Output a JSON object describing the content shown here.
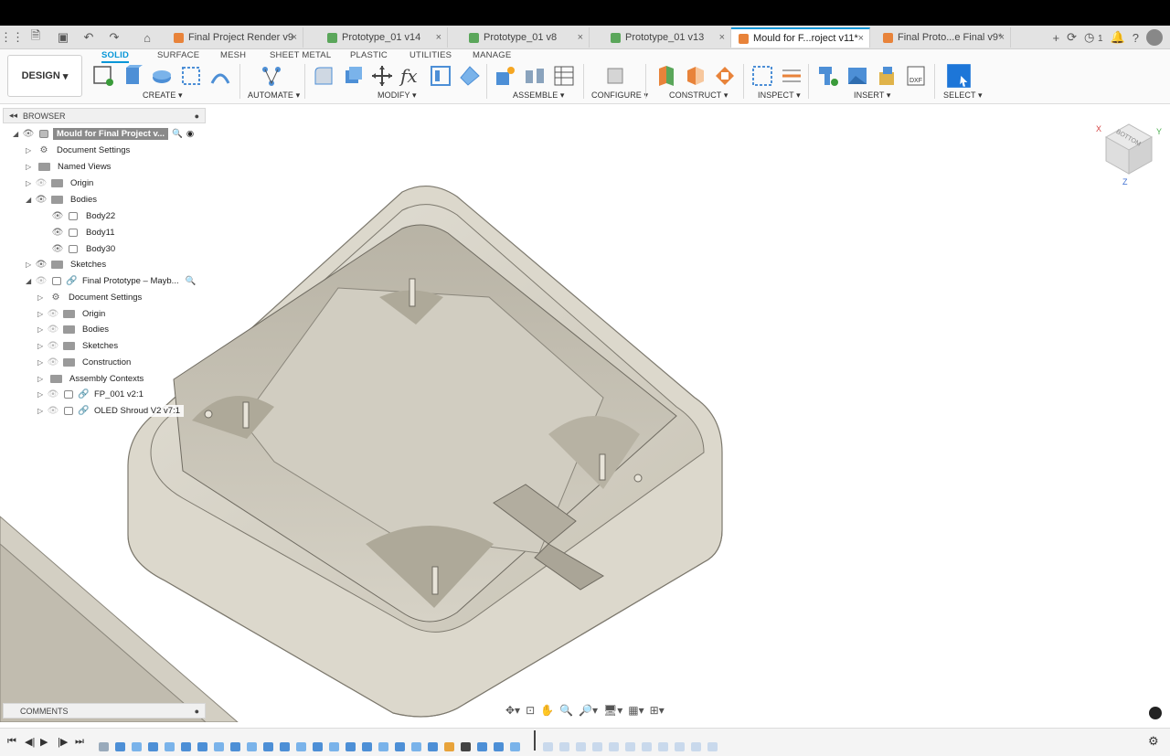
{
  "tabs": [
    {
      "label": "Final Project Render v9",
      "icon": "orange"
    },
    {
      "label": "Prototype_01 v14",
      "icon": "green"
    },
    {
      "label": "Prototype_01 v8",
      "icon": "green"
    },
    {
      "label": "Prototype_01 v13",
      "icon": "green"
    },
    {
      "label": "Mould for F...roject v11*",
      "icon": "orange",
      "active": true
    },
    {
      "label": "Final Proto...e Final v9*",
      "icon": "orange"
    }
  ],
  "notifications_count": "1",
  "workspace": "DESIGN",
  "ribbon_tabs": [
    "SOLID",
    "SURFACE",
    "MESH",
    "SHEET METAL",
    "PLASTIC",
    "UTILITIES",
    "MANAGE"
  ],
  "ribbon_groups": [
    "CREATE",
    "AUTOMATE",
    "MODIFY",
    "ASSEMBLE",
    "CONFIGURE",
    "CONSTRUCT",
    "INSPECT",
    "INSERT",
    "SELECT"
  ],
  "browser": {
    "title": "BROWSER",
    "root": "Mould for Final Project v...",
    "items": [
      {
        "label": "Document Settings",
        "type": "settings"
      },
      {
        "label": "Named Views",
        "type": "folder"
      },
      {
        "label": "Origin",
        "type": "folder"
      },
      {
        "label": "Bodies",
        "type": "folder"
      },
      {
        "label": "Body22",
        "type": "body"
      },
      {
        "label": "Body11",
        "type": "body"
      },
      {
        "label": "Body30",
        "type": "body"
      },
      {
        "label": "Sketches",
        "type": "folder"
      },
      {
        "label": "Final Prototype – Mayb...",
        "type": "component"
      },
      {
        "label": "Document Settings",
        "type": "settings"
      },
      {
        "label": "Origin",
        "type": "folder"
      },
      {
        "label": "Bodies",
        "type": "folder"
      },
      {
        "label": "Sketches",
        "type": "folder"
      },
      {
        "label": "Construction",
        "type": "folder"
      },
      {
        "label": "Assembly Contexts",
        "type": "folder"
      },
      {
        "label": "FP_001 v2:1",
        "type": "component"
      },
      {
        "label": "OLED Shroud V2 v7:1",
        "type": "component"
      }
    ]
  },
  "viewcube_face": "BOTTOM",
  "axes": {
    "x": "X",
    "y": "Y",
    "z": "Z"
  },
  "comments_label": "COMMENTS",
  "colors": {
    "accent": "#0696d7",
    "model": "#d9d5c9"
  }
}
